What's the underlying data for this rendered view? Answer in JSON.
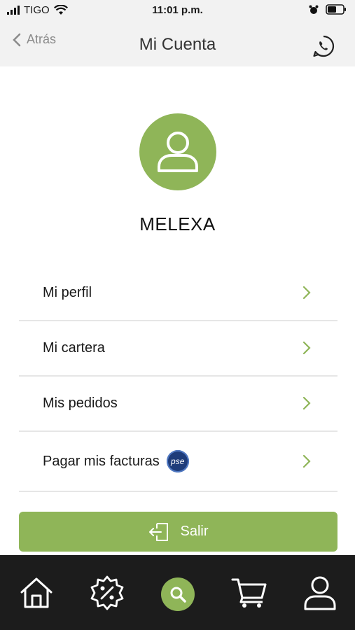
{
  "status_bar": {
    "carrier": "TIGO",
    "time": "11:01 p.m."
  },
  "header": {
    "back_label": "Atrás",
    "title": "Mi Cuenta",
    "whatsapp_icon": "whatsapp-icon"
  },
  "profile": {
    "avatar_icon": "user-icon",
    "username": "MELEXA"
  },
  "menu": {
    "items": [
      {
        "label": "Mi perfil"
      },
      {
        "label": "Mi cartera"
      },
      {
        "label": "Mis pedidos"
      },
      {
        "label": "Pagar mis facturas",
        "badge": "pse"
      }
    ]
  },
  "logout": {
    "label": "Salir"
  },
  "tabbar": {
    "items": [
      "home-icon",
      "discount-badge-icon",
      "search-icon",
      "cart-icon",
      "profile-icon"
    ]
  },
  "colors": {
    "accent": "#8fb558",
    "header_bg": "#f2f2f2",
    "tabbar_bg": "#1c1c1c"
  }
}
